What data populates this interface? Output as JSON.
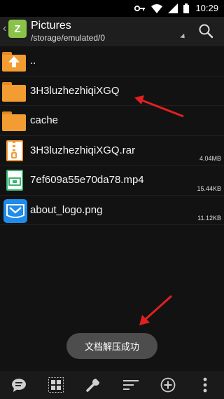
{
  "status_bar": {
    "time": "10:29",
    "icons": [
      "key-icon",
      "wifi-icon",
      "signal-icon",
      "battery-icon"
    ]
  },
  "app_bar": {
    "title": "Pictures",
    "path": "/storage/emulated/0",
    "logo_letter": "Z"
  },
  "files": [
    {
      "name": "..",
      "type": "up-folder",
      "size": ""
    },
    {
      "name": "3H3luzhezhiqiXGQ",
      "type": "folder",
      "size": ""
    },
    {
      "name": "cache",
      "type": "folder",
      "size": ""
    },
    {
      "name": "3H3luzhezhiqiXGQ.rar",
      "type": "archive",
      "size": "4.04MB"
    },
    {
      "name": "7ef609a55e70da78.mp4",
      "type": "video",
      "size": "15.44KB"
    },
    {
      "name": "about_logo.png",
      "type": "image",
      "size": "11.12KB"
    }
  ],
  "toast": "文档解压成功",
  "toolbar": [
    "chat-icon",
    "select-grid-icon",
    "wrench-icon",
    "sort-icon",
    "add-circle-icon",
    "more-vert-icon"
  ],
  "colors": {
    "background": "#121212",
    "folder": "#f39c31",
    "annotation_arrow": "#e02020",
    "logo": "#8bc34a",
    "png_icon": "#1f8bea"
  }
}
